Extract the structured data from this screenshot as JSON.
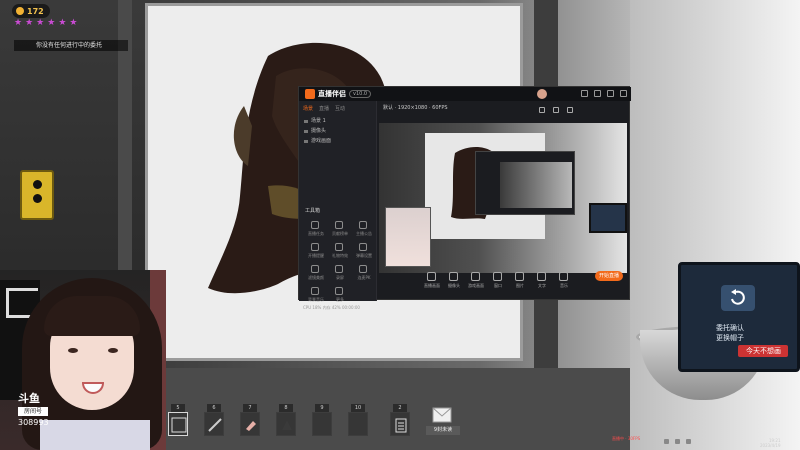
{
  "hud": {
    "coins": "172",
    "hint": "你没有任何进行中的委托"
  },
  "app": {
    "name": "直播伴侣",
    "version": "v10.0",
    "left_tabs": [
      "场景",
      "直播",
      "互动"
    ],
    "scenes": [
      "场景 1",
      "摄像头",
      "游戏画面"
    ],
    "tools_title": "工具箱",
    "tools": [
      "直播任务",
      "贡献榜单",
      "主播公告",
      "开播提醒",
      "礼物特效",
      "弹幕设置",
      "滤镜美颜",
      "录屏",
      "连麦PK",
      "背景音乐",
      "更多"
    ],
    "stage_title": "默认 · 1920×1080 · 60FPS",
    "bottom_buttons": [
      "直播画面",
      "摄像头",
      "游戏画面",
      "窗口",
      "图片",
      "文字",
      "音乐"
    ],
    "live_button": "开始直播",
    "status": "CPU 18%  内存 42%  00:00:00"
  },
  "webcam": {
    "platform_logo": "斗鱼",
    "room_label": "房间号",
    "room_number": "308993",
    "sign_text": "uto"
  },
  "hotbar": {
    "slots": [
      {
        "key": "5",
        "icon": "brush-icon"
      },
      {
        "key": "6",
        "icon": "pen-icon"
      },
      {
        "key": "7",
        "icon": "eraser-icon"
      },
      {
        "key": "8",
        "icon": "palette-icon"
      },
      {
        "key": "9",
        "icon": "empty-slot-icon"
      },
      {
        "key": "10",
        "icon": "empty-slot-icon"
      },
      {
        "key": "2",
        "icon": "clipboard-icon"
      }
    ],
    "mail_label": "9封未读"
  },
  "monitor": {
    "line1": "委托确认",
    "line2": "更换帽子",
    "tag": "今天不想画"
  },
  "taskbar": {
    "info": "直播中 · 30FPS",
    "time": "19:21",
    "date": "2023/4/19"
  },
  "colors": {
    "accent": "#f26a1b",
    "star": "#c94bd2",
    "coin": "#f2b234"
  }
}
